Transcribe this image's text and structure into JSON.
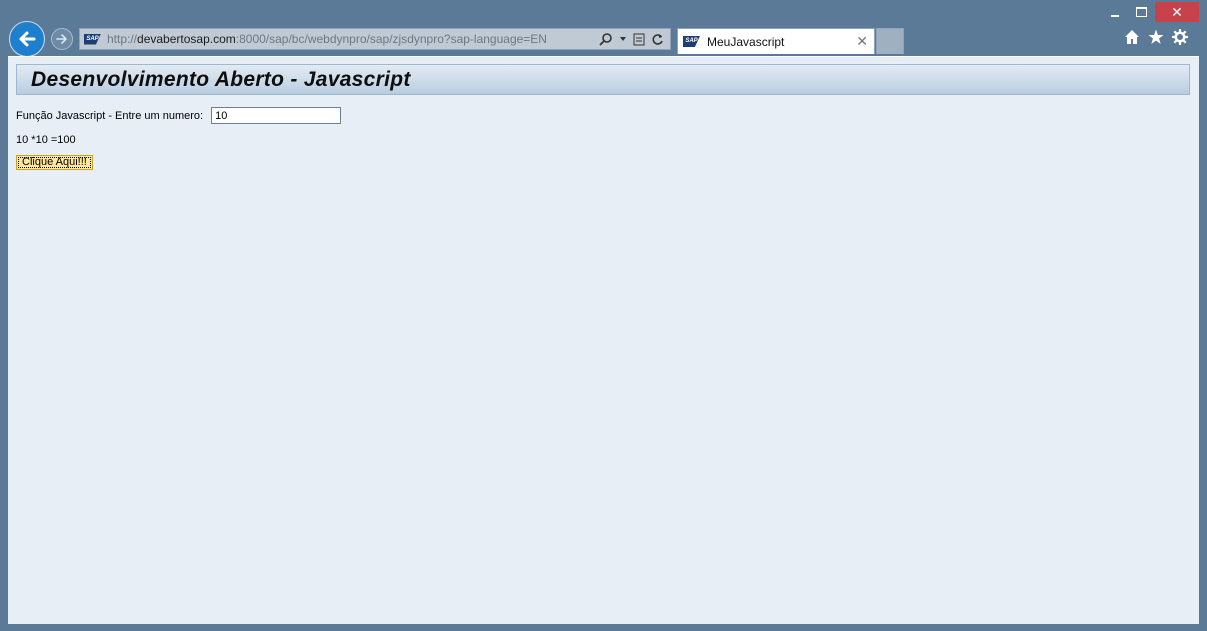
{
  "browser": {
    "url_prefix": "http://",
    "url_domain": "devabertosap.com",
    "url_rest": ":8000/sap/bc/webdynpro/sap/zjsdynpro?sap-language=EN",
    "tab_title": "MeuJavascript",
    "logo_text": "SAP"
  },
  "page": {
    "title": "Desenvolvimento Aberto - Javascript",
    "field_label": "Função Javascript - Entre um numero:",
    "input_value": "10",
    "result_text": "10 *10 =100",
    "button_label": "Clique Aqui!!!"
  }
}
